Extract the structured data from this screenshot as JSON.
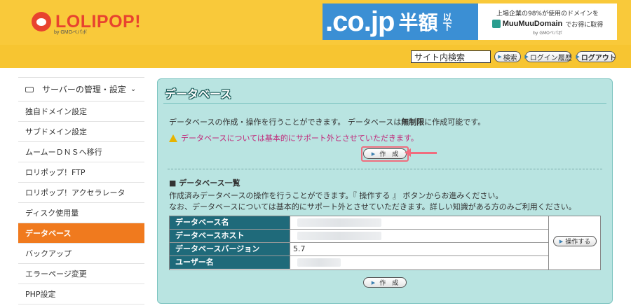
{
  "header": {
    "logo_text": "LOLIPOP!",
    "logo_sub": "by GMOペパボ",
    "banner": {
      "domain": ".co.jp",
      "half": "半額",
      "ika": "以下",
      "line1": "上場企業の98%が使用のドメインを",
      "brand": "MuuMuuDomain",
      "line2b": "でお得に取得",
      "line3": "by GMOペパボ"
    },
    "search_placeholder": "サイト内検索",
    "search_button": "検索",
    "login_history_button": "ログイン履歴",
    "logout_button": "ログアウト"
  },
  "sidebar": {
    "group_label": "サーバーの管理・設定",
    "items": [
      {
        "label": "独自ドメイン設定"
      },
      {
        "label": "サブドメイン設定"
      },
      {
        "label": "ムームーＤＮＳへ移行"
      },
      {
        "label": "ロリポップ！FTP"
      },
      {
        "label": "ロリポップ！アクセラレータ"
      },
      {
        "label": "ディスク使用量"
      },
      {
        "label": "データベース"
      },
      {
        "label": "バックアップ"
      },
      {
        "label": "エラーページ変更"
      },
      {
        "label": "PHP設定"
      }
    ]
  },
  "main": {
    "title": "データベース",
    "desc_prefix": "データベースの作成・操作を行うことができます。 データベースは",
    "desc_bold": "無制限",
    "desc_suffix": "に作成可能です。",
    "warning": "データベースについては基本的にサポート外とさせていただきます。",
    "create_button": "作　成",
    "list_title": "■ データベース一覧",
    "list_desc1": "作成済みデータベースの操作を行うことができます。『 操作する 』 ボタンからお進みください。",
    "list_desc2": "なお、データベースについては基本的にサポート外とさせていただきます。詳しい知識がある方のみご利用ください。",
    "table": {
      "rows": [
        {
          "key": "データベース名",
          "value": ""
        },
        {
          "key": "データベースホスト",
          "value": ""
        },
        {
          "key": "データベースバージョン",
          "value": "5.7"
        },
        {
          "key": "ユーザー名",
          "value": ""
        }
      ],
      "operate_button": "操作する"
    },
    "create_button_bottom": "作　成"
  },
  "colors": {
    "header_yellow": "#f7c531",
    "brand_red": "#e8432f",
    "panel_bg": "#b9e4e1",
    "table_key_bg": "#1f6a7a",
    "active_nav": "#f07a1e",
    "warning_text": "#c0297a",
    "highlight": "#f06d7e"
  }
}
